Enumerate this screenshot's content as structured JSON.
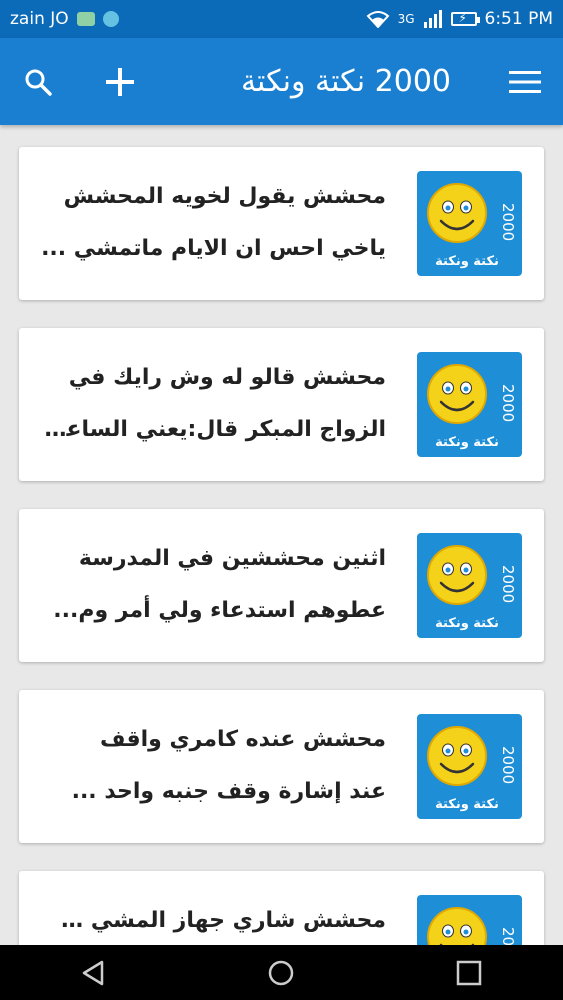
{
  "status_bar": {
    "carrier": "zain JO",
    "network_type": "3G",
    "time": "6:51 PM"
  },
  "app_bar": {
    "title": "2000 نكتة ونكتة",
    "icons": [
      "search-icon",
      "add-icon",
      "menu-icon"
    ],
    "color": "#1a7fd1"
  },
  "thumbnail": {
    "number": "2000",
    "caption": "نكتة ونكتة",
    "bg_color": "#1e8fd6"
  },
  "jokes": [
    {
      "line1": "محشش يقول لخويه المحشش",
      "line2": "ياخي احس ان الايام ماتمشي ..."
    },
    {
      "line1": "محشش قالو له وش رايك في",
      "line2": "الزواج المبكر قال:يعني الساعة..."
    },
    {
      "line1": "اثنين محششين في المدرسة",
      "line2": "عطوهم استدعاء ولي أمر وم..."
    },
    {
      "line1": "محشش عنده كامري  واقف",
      "line2": "عند إشارة   وقف جنبه واحد ..."
    },
    {
      "line1": "محشش شاري جهاز المشي شغله",
      "line2": ""
    }
  ],
  "nav_bar": {
    "icons": [
      "back-icon",
      "home-icon",
      "recents-icon"
    ]
  }
}
